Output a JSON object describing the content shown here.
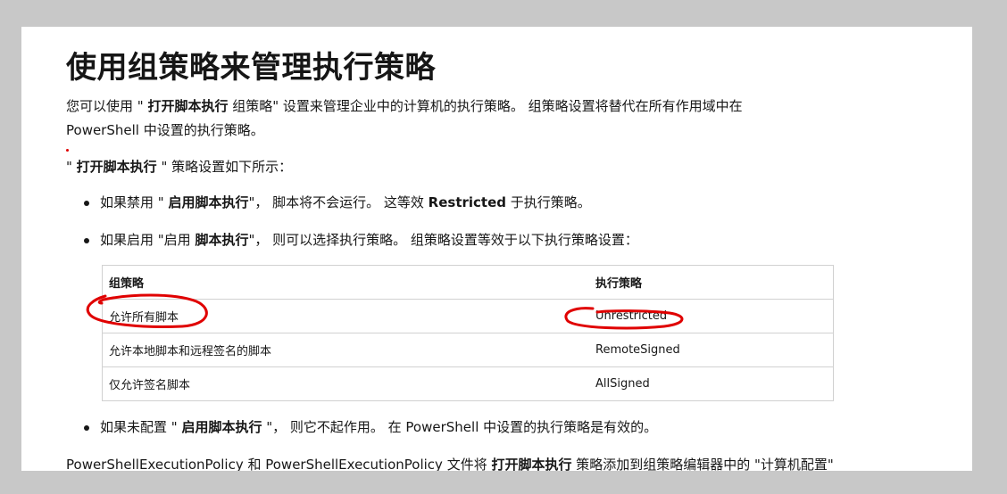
{
  "heading": "使用组策略来管理执行策略",
  "intro": {
    "pre": "您可以使用 \" ",
    "bold": "打开脚本执行",
    "post": " 组策略\" 设置来管理企业中的计算机的执行策略。 组策略设置将替代在所有作用域中在 PowerShell 中设置的执行策略。"
  },
  "setting_line": {
    "pre": "\" ",
    "bold": "打开脚本执行",
    "post": " \" 策略设置如下所示："
  },
  "bullets": [
    {
      "pre": "如果禁用 \" ",
      "bold": "启用脚本执行",
      "mid": "\"， 脚本将不会运行。 这等效 ",
      "bold2": "Restricted",
      "post": " 于执行策略。"
    },
    {
      "pre": "如果启用 \"启用 ",
      "bold": "脚本执行",
      "post": "\"， 则可以选择执行策略。 组策略设置等效于以下执行策略设置："
    },
    {
      "pre": "如果未配置 \" ",
      "bold": "启用脚本执行",
      "post": " \"， 则它不起作用。 在 PowerShell 中设置的执行策略是有效的。"
    }
  ],
  "table": {
    "headers": [
      "组策略",
      "执行策略"
    ],
    "rows": [
      [
        "允许所有脚本",
        "Unrestricted"
      ],
      [
        "允许本地脚本和远程签名的脚本",
        "RemoteSigned"
      ],
      [
        "仅允许签名脚本",
        "AllSigned"
      ]
    ]
  },
  "footer": {
    "pre": "PowerShellExecutionPolicy 和 PowerShellExecutionPolicy 文件将 ",
    "bold": "打开脚本执行",
    "post": " 策略添加到组策略编辑器中的 \"计算机配置\""
  },
  "annotation_color": "#e00000"
}
